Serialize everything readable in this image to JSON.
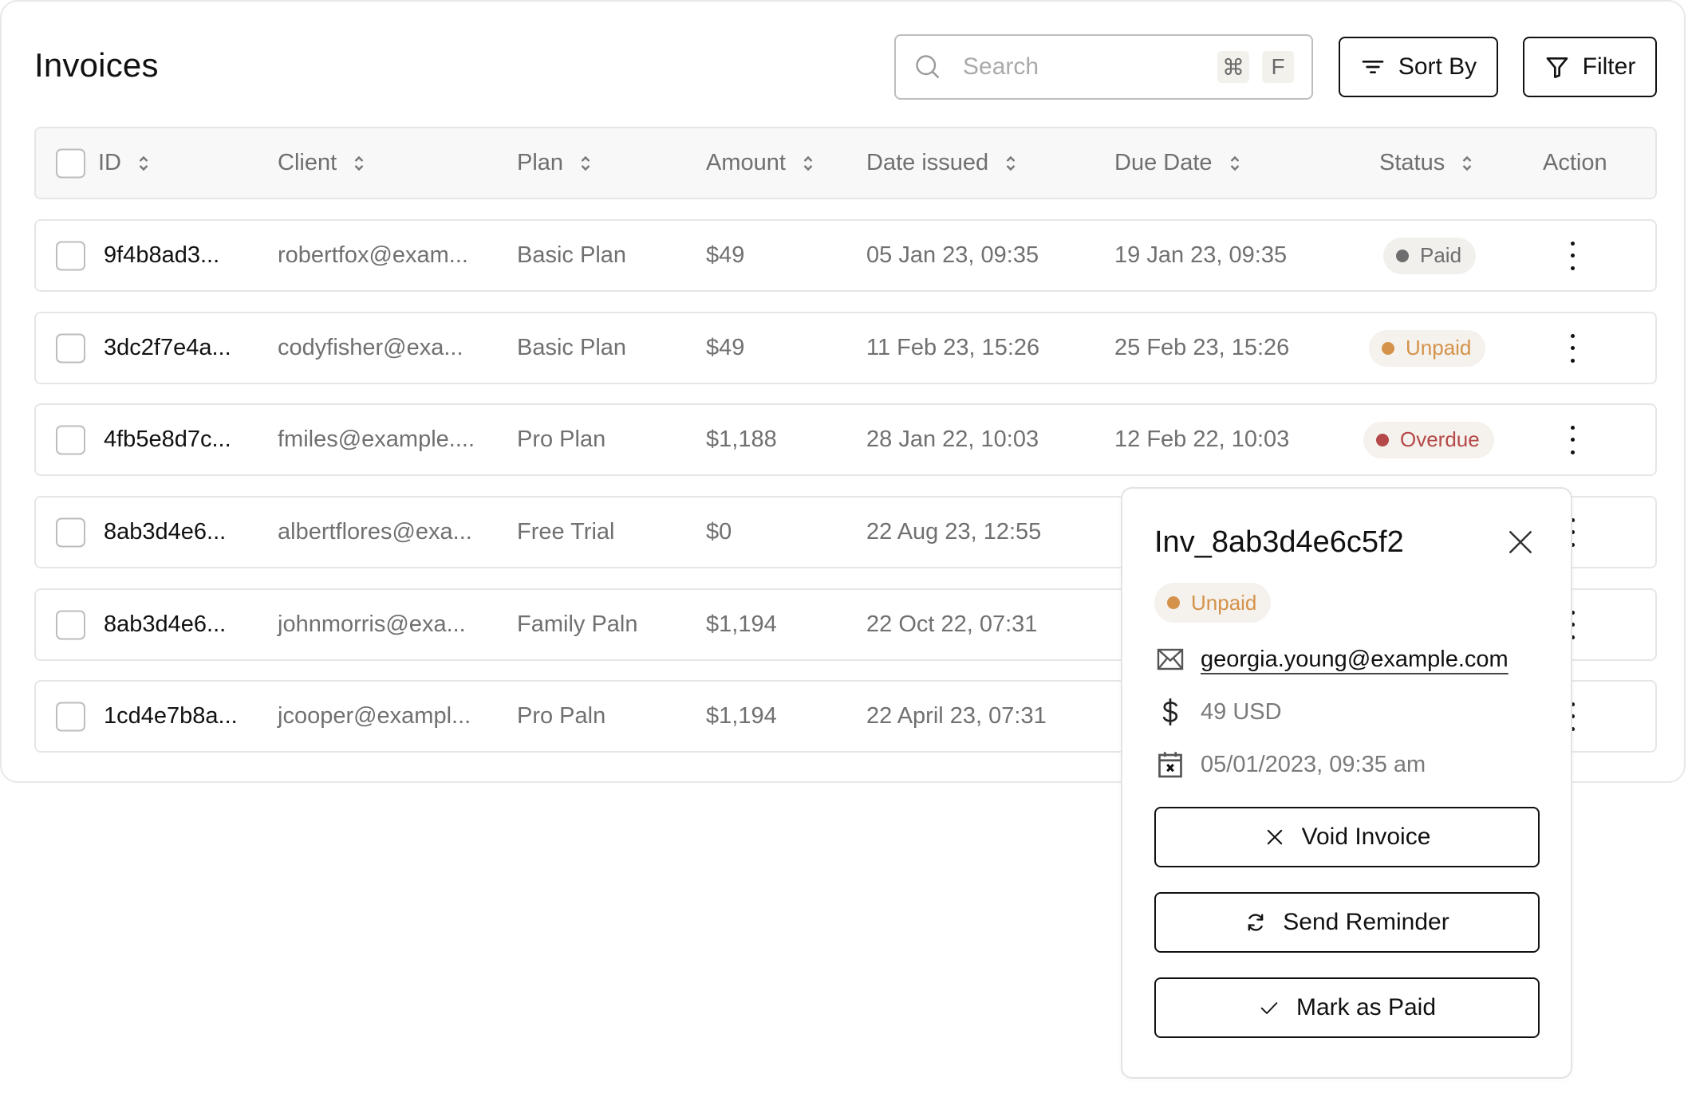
{
  "page": {
    "title": "Invoices"
  },
  "search": {
    "placeholder": "Search",
    "shortcut_keys": [
      "⌘",
      "F"
    ],
    "icon": "search-icon"
  },
  "toolbar": {
    "sort_label": "Sort By",
    "filter_label": "Filter",
    "sort_icon": "sort-lines-icon",
    "filter_icon": "funnel-icon"
  },
  "table": {
    "columns": [
      {
        "key": "id",
        "label": "ID",
        "sortable": true
      },
      {
        "key": "client",
        "label": "Client",
        "sortable": true
      },
      {
        "key": "plan",
        "label": "Plan",
        "sortable": true
      },
      {
        "key": "amount",
        "label": "Amount",
        "sortable": true
      },
      {
        "key": "date_issued",
        "label": "Date issued",
        "sortable": true
      },
      {
        "key": "due_date",
        "label": "Due Date",
        "sortable": true
      },
      {
        "key": "status",
        "label": "Status",
        "sortable": true
      },
      {
        "key": "action",
        "label": "Action",
        "sortable": false
      }
    ],
    "rows": [
      {
        "id": "9f4b8ad3...",
        "client": "robertfox@exam...",
        "plan": "Basic Plan",
        "amount": "$49",
        "date_issued": "05 Jan 23, 09:35",
        "due_date": "19 Jan 23, 09:35",
        "status": "Paid",
        "checked": false
      },
      {
        "id": "3dc2f7e4a...",
        "client": "codyfisher@exa...",
        "plan": "Basic Plan",
        "amount": "$49",
        "date_issued": "11 Feb 23, 15:26",
        "due_date": "25 Feb 23, 15:26",
        "status": "Unpaid",
        "checked": false
      },
      {
        "id": "4fb5e8d7c...",
        "client": "fmiles@example....",
        "plan": "Pro Plan",
        "amount": "$1,188",
        "date_issued": "28 Jan 22, 10:03",
        "due_date": "12 Feb 22, 10:03",
        "status": "Overdue",
        "checked": false
      },
      {
        "id": "8ab3d4e6...",
        "client": "albertflores@exa...",
        "plan": "Free Trial",
        "amount": "$0",
        "date_issued": "22 Aug 23, 12:55",
        "due_date": "",
        "status": "",
        "checked": false
      },
      {
        "id": "8ab3d4e6...",
        "client": "johnmorris@exa...",
        "plan": "Family Paln",
        "amount": "$1,194",
        "date_issued": "22 Oct 22, 07:31",
        "due_date": "",
        "status": "",
        "checked": false
      },
      {
        "id": "1cd4e7b8a...",
        "client": "jcooper@exampl...",
        "plan": "Pro Paln",
        "amount": "$1,194",
        "date_issued": "22 April 23, 07:31",
        "due_date": "",
        "status": "",
        "checked": false
      }
    ]
  },
  "status_colors": {
    "Paid": {
      "fg": "#6e6e6e",
      "bg": "#f1f0ed"
    },
    "Unpaid": {
      "fg": "#d4924a",
      "bg": "#f5f1ec"
    },
    "Overdue": {
      "fg": "#b54848",
      "bg": "#f5f1ec"
    }
  },
  "popup": {
    "title": "Inv_8ab3d4e6c5f2",
    "status": "Unpaid",
    "email": "georgia.young@example.com",
    "amount": "49 USD",
    "date": "05/01/2023, 09:35 am",
    "actions": [
      {
        "label": "Void Invoice",
        "icon": "x-icon"
      },
      {
        "label": "Send Reminder",
        "icon": "refresh-icon"
      },
      {
        "label": "Mark as Paid",
        "icon": "check-icon"
      }
    ]
  }
}
